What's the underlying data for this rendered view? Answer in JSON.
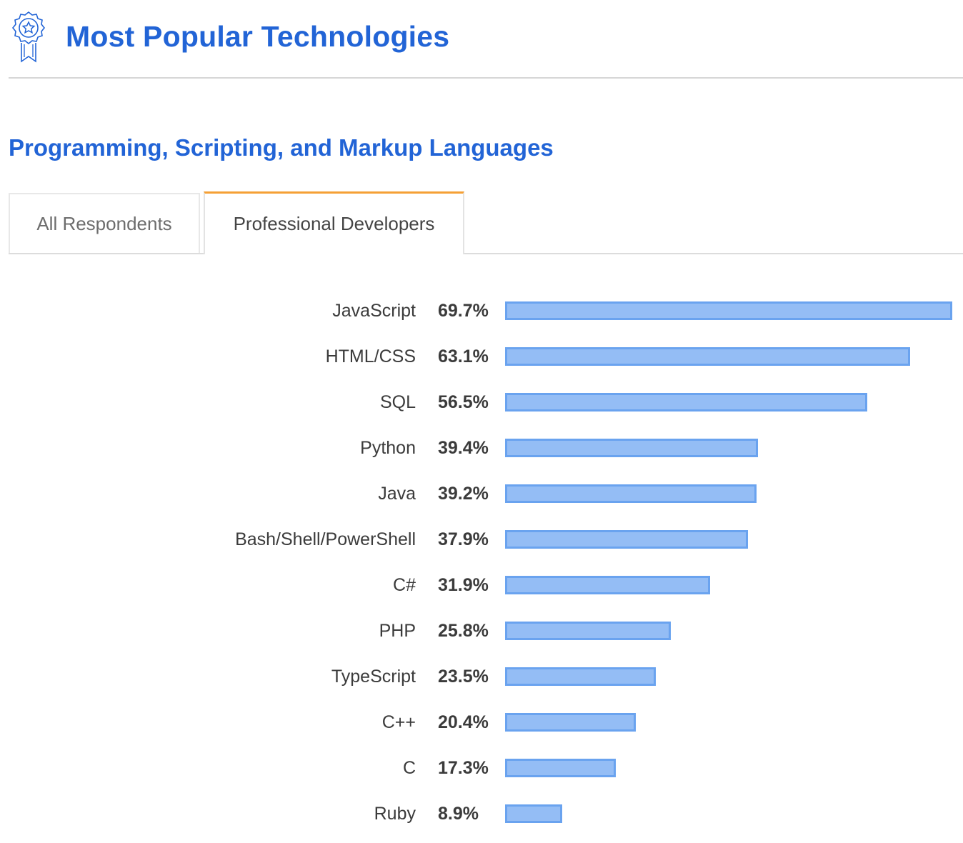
{
  "header": {
    "title": "Most Popular Technologies",
    "icon": "award-ribbon-icon"
  },
  "section": {
    "title": "Programming, Scripting, and Markup Languages"
  },
  "tabs": [
    {
      "label": "All Respondents",
      "active": false
    },
    {
      "label": "Professional Developers",
      "active": true
    }
  ],
  "colors": {
    "accent": "#2264d6",
    "tab_active_border": "#f5a035",
    "bar_fill": "#94bdf5",
    "bar_border": "#6aa3ef"
  },
  "chart_data": {
    "type": "bar",
    "orientation": "horizontal",
    "title": "Programming, Scripting, and Markup Languages",
    "series_name": "Professional Developers",
    "unit": "%",
    "categories": [
      "JavaScript",
      "HTML/CSS",
      "SQL",
      "Python",
      "Java",
      "Bash/Shell/PowerShell",
      "C#",
      "PHP",
      "TypeScript",
      "C++",
      "C",
      "Ruby"
    ],
    "values": [
      69.7,
      63.1,
      56.5,
      39.4,
      39.2,
      37.9,
      31.9,
      25.8,
      23.5,
      20.4,
      17.3,
      8.9
    ],
    "labels": [
      "69.7%",
      "63.1%",
      "56.5%",
      "39.4%",
      "39.2%",
      "37.9%",
      "31.9%",
      "25.8%",
      "23.5%",
      "20.4%",
      "17.3%",
      "8.9%"
    ],
    "xlim": [
      0,
      69.7
    ],
    "grid": false,
    "legend": "none"
  }
}
